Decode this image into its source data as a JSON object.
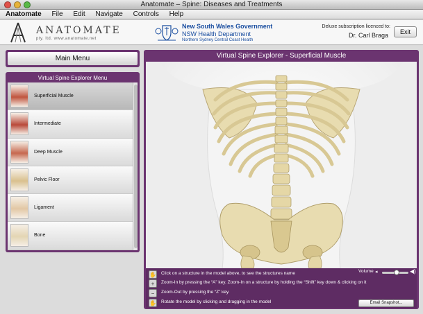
{
  "window": {
    "title": "Anatomate – Spine: Diseases and Treatments"
  },
  "menubar": {
    "items": [
      "Anatomate",
      "File",
      "Edit",
      "Navigate",
      "Controls",
      "Help"
    ]
  },
  "header": {
    "logo_text": "ANATOMATE",
    "logo_sub": "pty. ltd.   www.anatomate.net",
    "nsw_gov": "New South Wales Government",
    "nsw_dept": "NSW Health Department",
    "nsw_area": "Northern Sydney Central Coast Health",
    "subscription_label": "Deluxe subscription licenced to:",
    "subscription_name": "Dr. Carl Braga",
    "exit_label": "Exit"
  },
  "main_menu": {
    "label": "Main Menu"
  },
  "side_menu": {
    "title": "Virtual Spine Explorer Menu",
    "items": [
      {
        "label": "Superficial Muscle",
        "selected": true,
        "thumb_color": "#c0553f"
      },
      {
        "label": "Intermediate",
        "selected": false,
        "thumb_color": "#b94a3a"
      },
      {
        "label": "Deep Muscle",
        "selected": false,
        "thumb_color": "#c6684f"
      },
      {
        "label": "Pelvic Floor",
        "selected": false,
        "thumb_color": "#d9c08e"
      },
      {
        "label": "Ligament",
        "selected": false,
        "thumb_color": "#e2c7a4"
      },
      {
        "label": "Bone",
        "selected": false,
        "thumb_color": "#e3d5b3"
      }
    ]
  },
  "viewer": {
    "title": "Virtual Spine Explorer - Superficial Muscle",
    "instructions": [
      {
        "icon": "hand-icon",
        "text": "Click on a structure in the model above, to see the structures name"
      },
      {
        "icon": "zoom-in-icon",
        "text": "Zoom-In by pressing the “A” key.    Zoom-In on a structure by holding the “Shift” key down & clicking on it"
      },
      {
        "icon": "zoom-out-icon",
        "text": "Zoom-Out by pressing the “Z” key."
      },
      {
        "icon": "rotate-hand-icon",
        "text": "Rotate the model by clicking and dragging in the model"
      }
    ],
    "volume_label": "Volume",
    "volume_level": 0.55,
    "email_label": "Email Snapshot..."
  },
  "colors": {
    "accent": "#6b3470",
    "bone": "#e8dcb0",
    "body": "#f2f2f2",
    "nsw_blue": "#1a4ea0"
  }
}
